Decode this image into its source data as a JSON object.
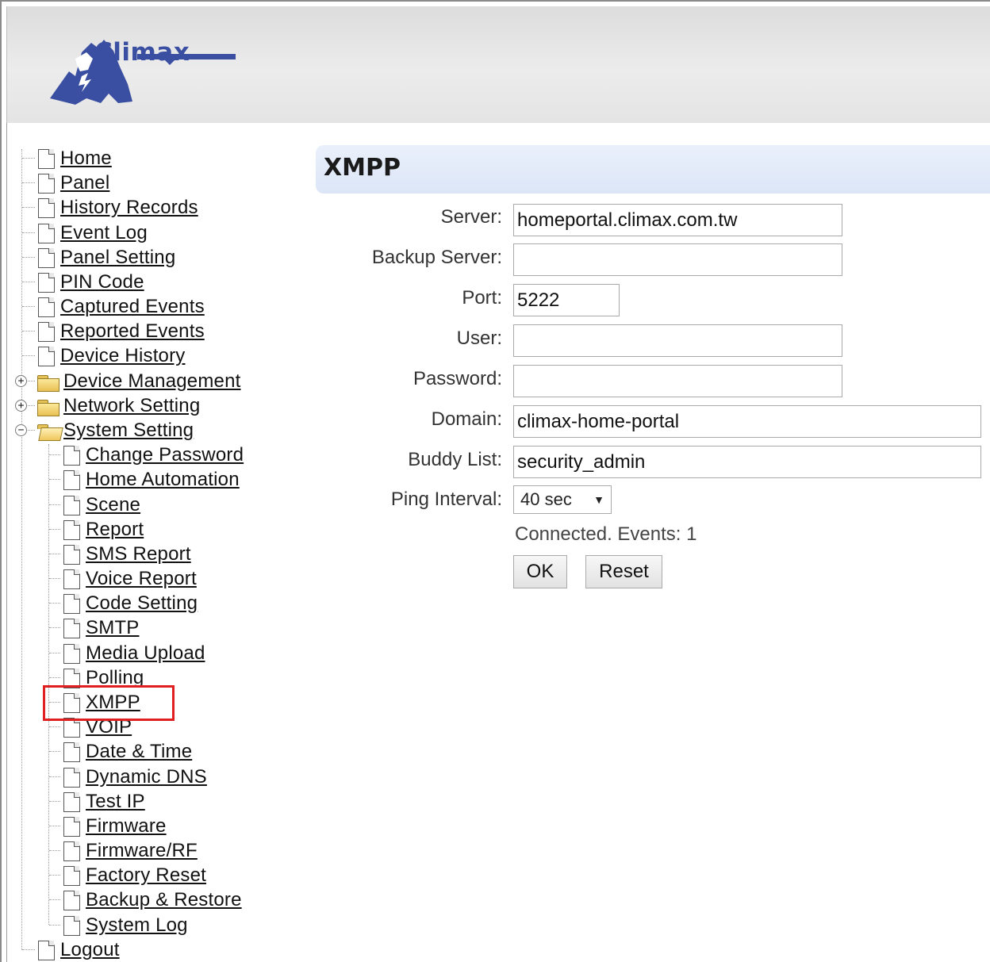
{
  "header": {
    "logo_text": "Climax"
  },
  "tree": {
    "items": [
      {
        "label": "Home",
        "kind": "page",
        "level": 0
      },
      {
        "label": "Panel",
        "kind": "page",
        "level": 0
      },
      {
        "label": "History Records",
        "kind": "page",
        "level": 0
      },
      {
        "label": "Event Log",
        "kind": "page",
        "level": 0
      },
      {
        "label": "Panel Setting",
        "kind": "page",
        "level": 0
      },
      {
        "label": "PIN Code",
        "kind": "page",
        "level": 0
      },
      {
        "label": "Captured Events",
        "kind": "page",
        "level": 0
      },
      {
        "label": "Reported Events",
        "kind": "page",
        "level": 0
      },
      {
        "label": "Device History",
        "kind": "page",
        "level": 0
      },
      {
        "label": "Device Management",
        "kind": "folder",
        "level": 0,
        "expander": "+"
      },
      {
        "label": "Network Setting",
        "kind": "folder",
        "level": 0,
        "expander": "+"
      },
      {
        "label": "System Setting",
        "kind": "folder-open",
        "level": 0,
        "expander": "−"
      },
      {
        "label": "Change Password",
        "kind": "page",
        "level": 1
      },
      {
        "label": "Home Automation",
        "kind": "page",
        "level": 1
      },
      {
        "label": "Scene",
        "kind": "page",
        "level": 1
      },
      {
        "label": "Report",
        "kind": "page",
        "level": 1
      },
      {
        "label": "SMS Report",
        "kind": "page",
        "level": 1
      },
      {
        "label": "Voice Report",
        "kind": "page",
        "level": 1
      },
      {
        "label": "Code Setting",
        "kind": "page",
        "level": 1
      },
      {
        "label": "SMTP",
        "kind": "page",
        "level": 1
      },
      {
        "label": "Media Upload",
        "kind": "page",
        "level": 1
      },
      {
        "label": "Polling",
        "kind": "page",
        "level": 1
      },
      {
        "label": "XMPP",
        "kind": "page",
        "level": 1,
        "selected": true
      },
      {
        "label": "VOIP",
        "kind": "page",
        "level": 1
      },
      {
        "label": "Date & Time",
        "kind": "page",
        "level": 1
      },
      {
        "label": "Dynamic DNS",
        "kind": "page",
        "level": 1
      },
      {
        "label": "Test IP",
        "kind": "page",
        "level": 1
      },
      {
        "label": "Firmware",
        "kind": "page",
        "level": 1
      },
      {
        "label": "Firmware/RF",
        "kind": "page",
        "level": 1
      },
      {
        "label": "Factory Reset",
        "kind": "page",
        "level": 1
      },
      {
        "label": "Backup & Restore",
        "kind": "page",
        "level": 1
      },
      {
        "label": "System Log",
        "kind": "page",
        "level": 1
      },
      {
        "label": "Logout",
        "kind": "page",
        "level": 0
      }
    ]
  },
  "page": {
    "title": "XMPP",
    "form": {
      "server_label": "Server:",
      "server_value": "homeportal.climax.com.tw",
      "backup_server_label": "Backup Server:",
      "backup_server_value": "",
      "port_label": "Port:",
      "port_value": "5222",
      "user_label": "User:",
      "user_value": "",
      "password_label": "Password:",
      "password_value": "",
      "domain_label": "Domain:",
      "domain_value": "climax-home-portal",
      "buddy_list_label": "Buddy List:",
      "buddy_list_value": "security_admin",
      "ping_interval_label": "Ping Interval:",
      "ping_interval_value": "40 sec"
    },
    "status": "Connected. Events: 1",
    "ok_label": "OK",
    "reset_label": "Reset"
  },
  "colors": {
    "highlight": "#e02020",
    "brand": "#3a4fa1",
    "title_bar": "#dce6f7"
  }
}
